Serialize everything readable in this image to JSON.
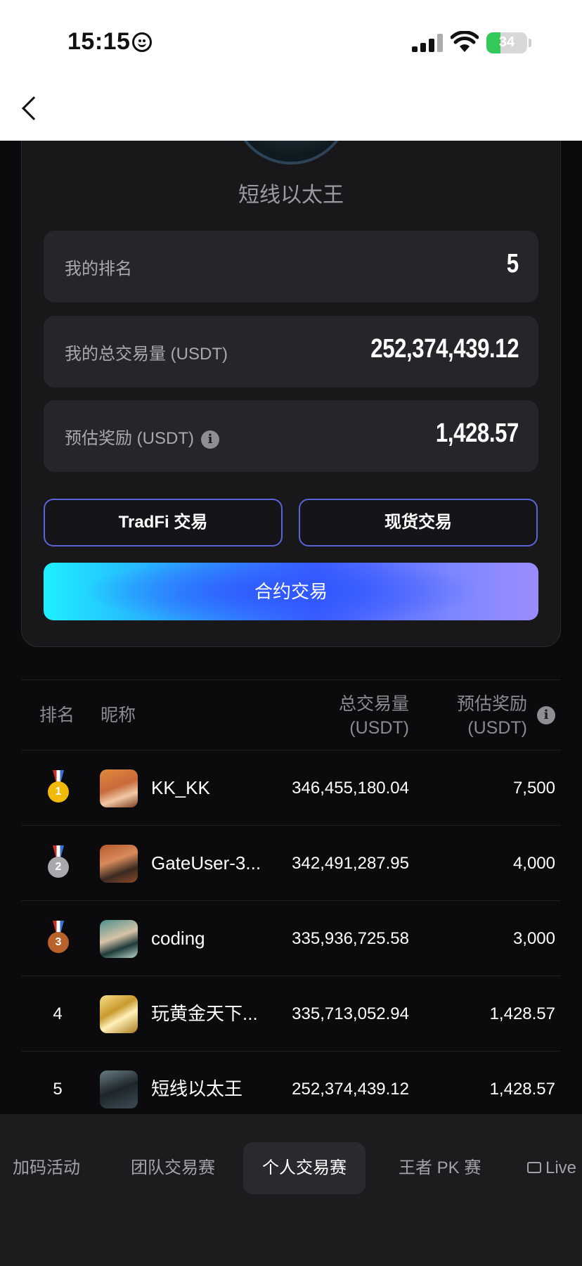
{
  "status_bar": {
    "time": "15:15",
    "battery": "34"
  },
  "profile": {
    "name": "短线以太王"
  },
  "stats": [
    {
      "label": "我的排名",
      "value": "5"
    },
    {
      "label": "我的总交易量 (USDT)",
      "value": "252,374,439.12"
    },
    {
      "label": "预估奖励 (USDT)",
      "value": "1,428.57"
    }
  ],
  "buttons": {
    "tradfi": "TradFi 交易",
    "spot": "现货交易",
    "futures": "合约交易"
  },
  "table": {
    "headers": {
      "rank": "排名",
      "nickname": "昵称",
      "volume_line1": "总交易量",
      "volume_line2": "(USDT)",
      "reward_line1": "预估奖励",
      "reward_line2": "(USDT)"
    },
    "rows": [
      {
        "rank": "1",
        "nickname": "KK_KK",
        "volume": "346,455,180.04",
        "reward": "7,500"
      },
      {
        "rank": "2",
        "nickname": "GateUser-3...",
        "volume": "342,491,287.95",
        "reward": "4,000"
      },
      {
        "rank": "3",
        "nickname": "coding",
        "volume": "335,936,725.58",
        "reward": "3,000"
      },
      {
        "rank": "4",
        "nickname": "玩黄金天下...",
        "volume": "335,713,052.94",
        "reward": "1,428.57"
      },
      {
        "rank": "5",
        "nickname": "短线以太王",
        "volume": "252,374,439.12",
        "reward": "1,428.57"
      }
    ]
  },
  "bottom_tabs": [
    "加码活动",
    "团队交易赛",
    "个人交易赛",
    "王者 PK 赛",
    "Live"
  ],
  "active_tab": "个人交易赛",
  "colors": {
    "gold": "#f0b90b",
    "silver": "#a8a8ad",
    "bronze": "#b8622c",
    "outline": "#5b63d8"
  }
}
